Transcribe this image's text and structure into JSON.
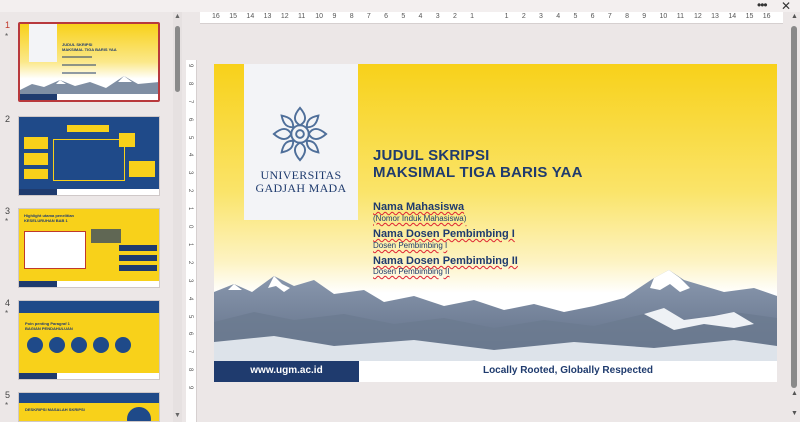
{
  "window": {
    "more_label": "•••",
    "close_label": "✕"
  },
  "ruler": {
    "horizontal_labels": [
      "16",
      "15",
      "14",
      "13",
      "12",
      "11",
      "10",
      "9",
      "8",
      "7",
      "6",
      "5",
      "4",
      "3",
      "2",
      "1",
      "",
      "1",
      "2",
      "3",
      "4",
      "5",
      "6",
      "7",
      "8",
      "9",
      "10",
      "11",
      "12",
      "13",
      "14",
      "15",
      "16"
    ],
    "vertical_labels": [
      "9",
      "8",
      "7",
      "6",
      "5",
      "4",
      "3",
      "2",
      "1",
      "0",
      "1",
      "2",
      "3",
      "4",
      "5",
      "6",
      "7",
      "8",
      "9"
    ]
  },
  "thumbnails": [
    {
      "number": "1",
      "star": "*",
      "selected": true,
      "title": "JUDUL SKRIPSI\nMAKSIMAL TIGA BARIS YAA",
      "url": "www.ugm.ac.id",
      "tag": "Locally Rooted, Globally Respected"
    },
    {
      "number": "2",
      "star": "",
      "selected": false,
      "title": "",
      "url": "www.ugm.ac.id",
      "tag": "Locally Rooted, Globally Respected"
    },
    {
      "number": "3",
      "star": "*",
      "selected": false,
      "title": "Highlight utama penelitian\nKESELURUHAN BAB 1",
      "url": "www.ugm.ac.id",
      "tag": "Locally Rooted, Globally Respected"
    },
    {
      "number": "4",
      "star": "*",
      "selected": false,
      "title": "Poin penting Paragraf 1\nBAGIAN PENDAHULUAN",
      "url": "www.ugm.ac.id",
      "tag": "Locally Rooted, Globally Respected"
    },
    {
      "number": "5",
      "star": "*",
      "selected": false,
      "title": "DESKRIPSI MASALAH SKRIPSI",
      "url": "",
      "tag": ""
    }
  ],
  "slide": {
    "university_line1": "UNIVERSITAS",
    "university_line2": "GADJAH MADA",
    "title_line1": "JUDUL SKRIPSI",
    "title_line2": "MAKSIMAL TIGA BARIS YAA",
    "student_name": "Nama Mahasiswa",
    "student_id": "(Nomor Induk Mahasiswa)",
    "supervisor1_label": "Nama Dosen Pembimbing I",
    "supervisor1_role": "Dosen Pembimbing I",
    "supervisor2_label": "Nama Dosen Pembimbing II",
    "supervisor2_role": "Dosen Pembimbing II",
    "footer_url": "www.ugm.ac.id",
    "footer_tagline": "Locally Rooted, Globally Respected"
  },
  "colors": {
    "navy": "#1f3b6e",
    "yellow": "#f8d11a",
    "selection": "#b8393d"
  }
}
